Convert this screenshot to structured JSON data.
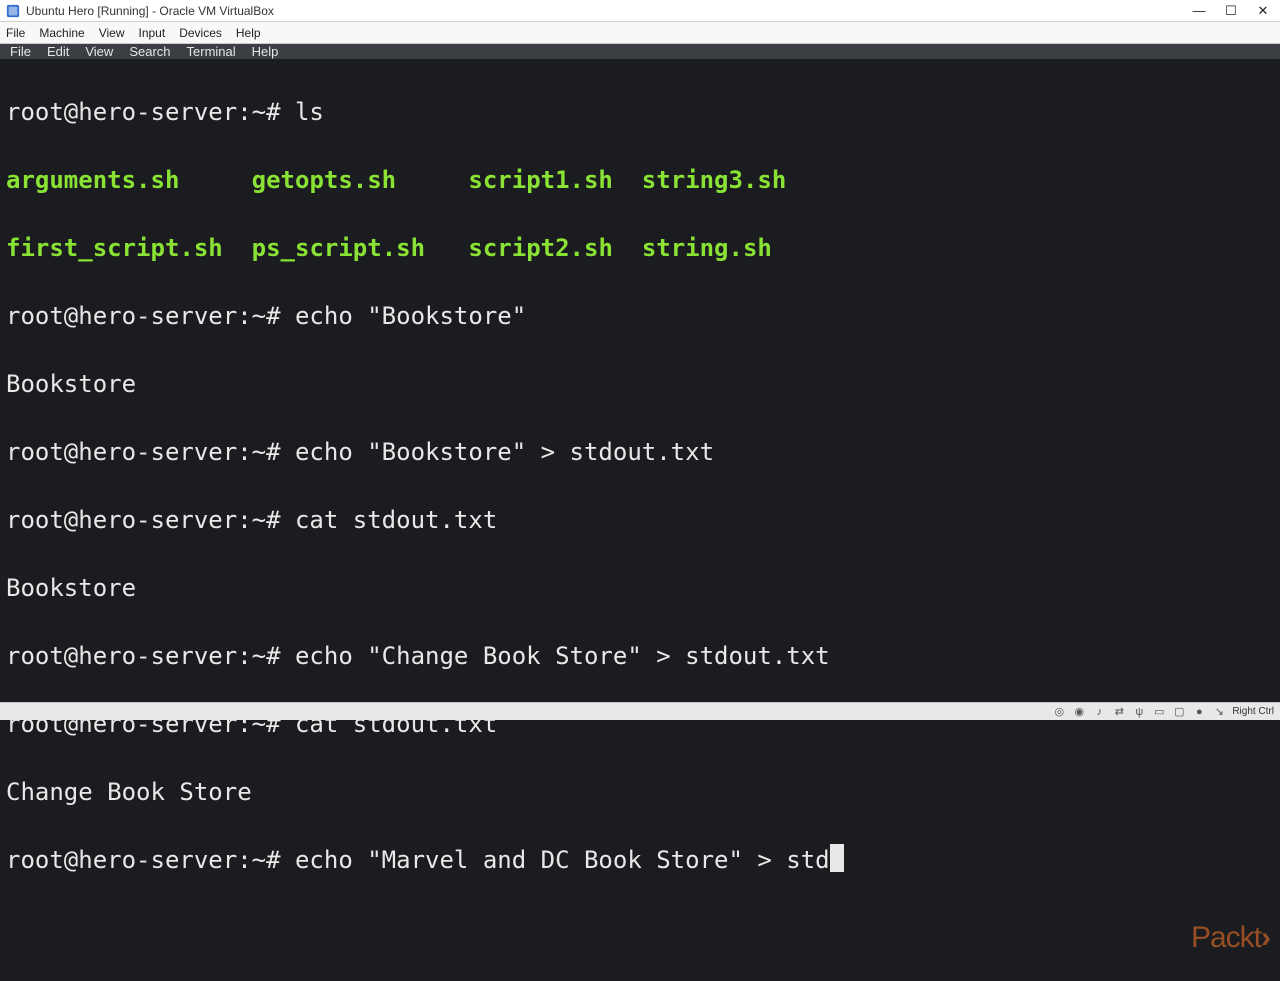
{
  "window": {
    "title": "Ubuntu Hero [Running] - Oracle VM VirtualBox"
  },
  "vb_menu": {
    "file": "File",
    "machine": "Machine",
    "view": "View",
    "input": "Input",
    "devices": "Devices",
    "help": "Help"
  },
  "term_menu": {
    "file": "File",
    "edit": "Edit",
    "view": "View",
    "search": "Search",
    "terminal": "Terminal",
    "help": "Help"
  },
  "prompt": "root@hero-server:~# ",
  "lines": {
    "l0_cmd": "ls",
    "l1_files_row1": {
      "c0": "arguments.sh",
      "c1": "getopts.sh",
      "c2": "script1.sh",
      "c3": "string3.sh"
    },
    "l2_files_row2": {
      "c0": "first_script.sh",
      "c1": "ps_script.sh",
      "c2": "script2.sh",
      "c3": "string.sh"
    },
    "l3_cmd": "echo \"Bookstore\"",
    "l4_out": "Bookstore",
    "l5_cmd": "echo \"Bookstore\" > stdout.txt",
    "l6_cmd": "cat stdout.txt",
    "l7_out": "Bookstore",
    "l8_cmd": "echo \"Change Book Store\" > stdout.txt",
    "l9_cmd": "cat stdout.txt",
    "l10_out": "Change Book Store",
    "l11_cmd": "echo \"Marvel and DC Book Store\" > std"
  },
  "status": {
    "hostkey": "Right Ctrl"
  },
  "watermark": "Packt"
}
